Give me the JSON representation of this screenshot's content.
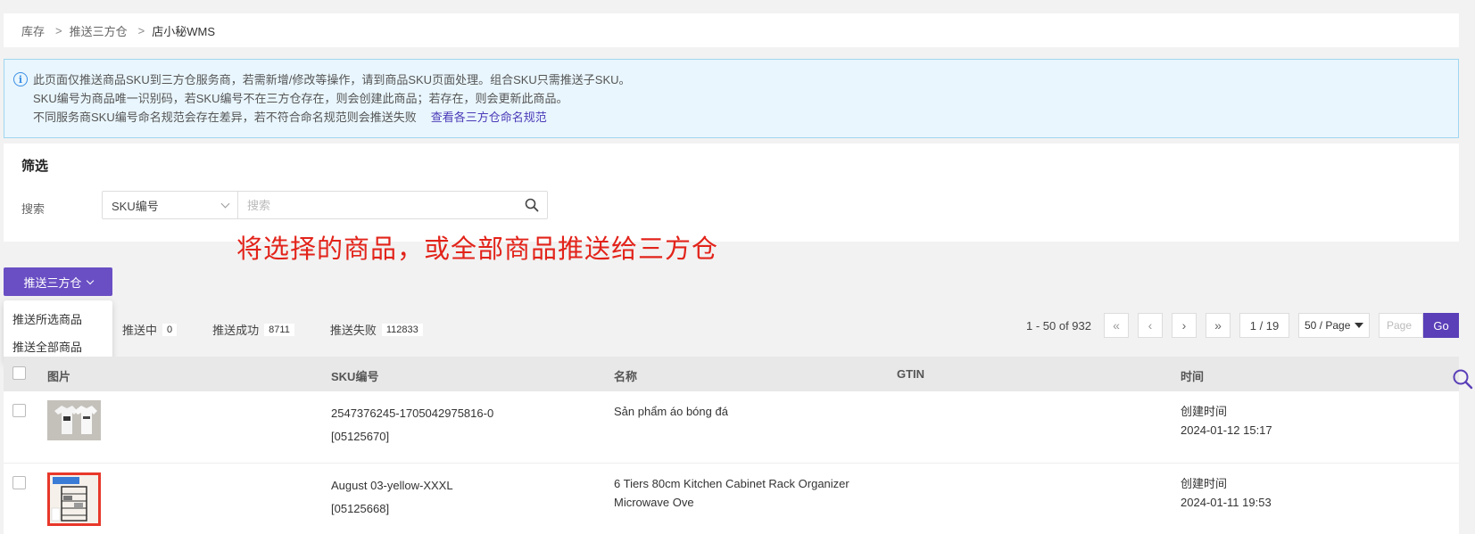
{
  "breadcrumb": {
    "items": [
      "库存",
      "推送三方仓"
    ],
    "current": "店小秘WMS"
  },
  "notice": {
    "line1": "此页面仅推送商品SKU到三方仓服务商，若需新增/修改等操作，请到商品SKU页面处理。组合SKU只需推送子SKU。",
    "line2": "SKU编号为商品唯一识别码，若SKU编号不在三方仓存在，则会创建此商品；若存在，则会更新此商品。",
    "line3": "不同服务商SKU编号命名规范会存在差异，若不符合命名规范则会推送失败",
    "link": "查看各三方仓命名规范"
  },
  "filter": {
    "title": "筛选",
    "search_label": "搜索",
    "search_type": "SKU编号",
    "search_placeholder": "搜索"
  },
  "annotation": "将选择的商品，或全部商品推送给三方仓",
  "push_button": {
    "label": "推送三方仓"
  },
  "dropdown": {
    "items": [
      "推送所选商品",
      "推送全部商品"
    ]
  },
  "status_tabs": [
    {
      "label": "推送中",
      "count": "0"
    },
    {
      "label": "推送成功",
      "count": "8711"
    },
    {
      "label": "推送失败",
      "count": "112833"
    }
  ],
  "pagination": {
    "range": "1 - 50 of 932",
    "current": "1 / 19",
    "page_size": "50 / Page",
    "page_placeholder": "Page",
    "go": "Go"
  },
  "table": {
    "headers": {
      "image": "图片",
      "sku": "SKU编号",
      "name": "名称",
      "gtin": "GTIN",
      "time": "时间"
    },
    "rows": [
      {
        "sku": "2547376245-1705042975816-0",
        "sku_id": "[05125670]",
        "name1": "Sản phẩm áo bóng đá",
        "name2": "",
        "time_label": "创建时间",
        "time": "2024-01-12 15:17"
      },
      {
        "sku": "August 03-yellow-XXXL",
        "sku_id": "[05125668]",
        "name1": "6 Tiers 80cm Kitchen Cabinet Rack Organizer",
        "name2": "Microwave Ove",
        "time_label": "创建时间",
        "time": "2024-01-11 19:53"
      }
    ]
  },
  "colors": {
    "primary": "#6a4fc4",
    "annotation": "#e2231a",
    "notice_bg": "#e9f6fd",
    "link": "#4b3ab8"
  }
}
